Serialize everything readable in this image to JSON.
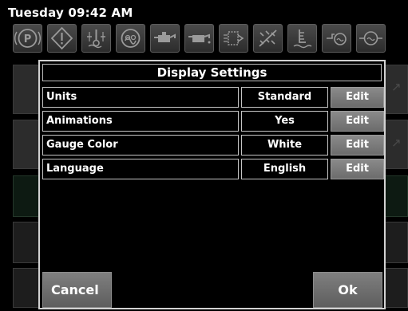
{
  "status_bar": {
    "clock": "Tuesday 09:42 AM"
  },
  "warning_lamps": [
    {
      "icon": "parking-brake-icon"
    },
    {
      "icon": "master-warning-icon"
    },
    {
      "icon": "coolant-temperature-icon"
    },
    {
      "icon": "glow-plug-icon"
    },
    {
      "icon": "oil-pressure-icon"
    },
    {
      "icon": "oil-can-icon"
    },
    {
      "icon": "engine-heater-icon"
    },
    {
      "icon": "regen-inhibit-icon"
    },
    {
      "icon": "fuel-water-icon"
    },
    {
      "icon": "hydraulic-filter-icon"
    },
    {
      "icon": "transmission-icon"
    }
  ],
  "modal": {
    "title": "Display Settings",
    "settings": [
      {
        "name": "Units",
        "value": "Standard",
        "action": "Edit"
      },
      {
        "name": "Animations",
        "value": "Yes",
        "action": "Edit"
      },
      {
        "name": "Gauge Color",
        "value": "White",
        "action": "Edit"
      },
      {
        "name": "Language",
        "value": "English",
        "action": "Edit"
      }
    ],
    "cancel_label": "Cancel",
    "ok_label": "Ok"
  },
  "colors": {
    "background": "#000000",
    "lamp_fill": "#3a3a3a",
    "modal_border": "#d2d2d2",
    "button_fill": "#777777",
    "text": "#ffffff"
  }
}
